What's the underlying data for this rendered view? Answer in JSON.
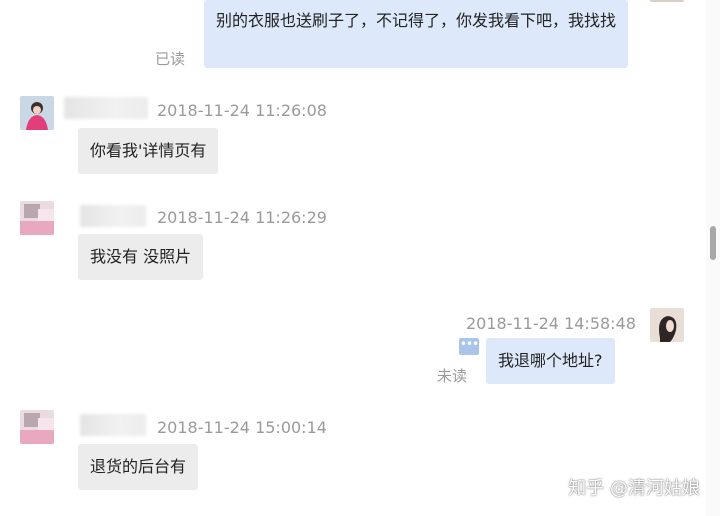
{
  "messages": [
    {
      "direction": "out",
      "text": "别的衣服也送刷子了，不记得了，你发我看下吧，我找找",
      "status": "已读"
    },
    {
      "direction": "in",
      "timestamp": "2018-11-24 11:26:08",
      "text": "你看我'详情页有"
    },
    {
      "direction": "in",
      "timestamp": "2018-11-24 11:26:29",
      "text": "我没有  没照片"
    },
    {
      "direction": "out",
      "timestamp": "2018-11-24 14:58:48",
      "text": "我退哪个地址?",
      "status": "未读"
    },
    {
      "direction": "in",
      "timestamp": "2018-11-24 15:00:14",
      "text": "退货的后台有"
    }
  ],
  "icons": {
    "more": "more-dots-icon"
  },
  "colors": {
    "incoming_bubble": "#ececec",
    "outgoing_bubble": "#dde9fb",
    "meta_text": "#9a9a9a"
  },
  "watermark": "知乎 @清河姑娘"
}
